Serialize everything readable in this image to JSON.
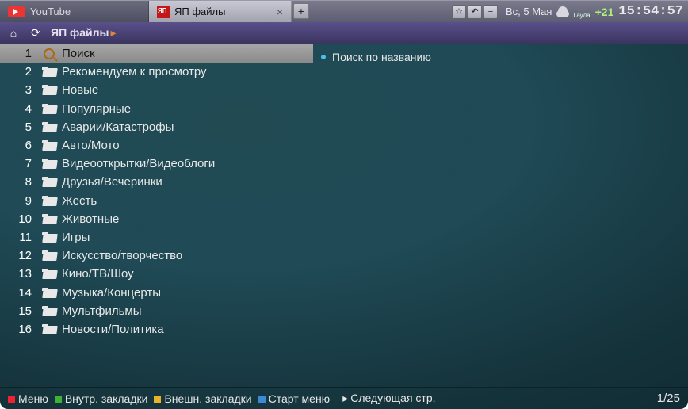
{
  "tabs": {
    "inactive_label": "YouTube",
    "active_label": "ЯП файлы"
  },
  "status": {
    "date": "Вс, 5 Мая",
    "city": "Гаула",
    "temp": "+21",
    "time": "15:54:57"
  },
  "toolbar": {
    "crumb": "ЯП файлы"
  },
  "detail": {
    "desc": "Поиск по названию"
  },
  "list": {
    "items": [
      {
        "n": "1",
        "type": "search",
        "label": "Поиск",
        "selected": true
      },
      {
        "n": "2",
        "type": "folder",
        "label": "Рекомендуем к просмотру"
      },
      {
        "n": "3",
        "type": "folder",
        "label": "Новые"
      },
      {
        "n": "4",
        "type": "folder",
        "label": "Популярные"
      },
      {
        "n": "5",
        "type": "folder",
        "label": "Аварии/Катастрофы"
      },
      {
        "n": "6",
        "type": "folder",
        "label": "Авто/Мото"
      },
      {
        "n": "7",
        "type": "folder",
        "label": "Видеооткрытки/Видеоблоги"
      },
      {
        "n": "8",
        "type": "folder",
        "label": "Друзья/Вечеринки"
      },
      {
        "n": "9",
        "type": "folder",
        "label": "Жесть"
      },
      {
        "n": "10",
        "type": "folder",
        "label": "Животные"
      },
      {
        "n": "11",
        "type": "folder",
        "label": "Игры"
      },
      {
        "n": "12",
        "type": "folder",
        "label": "Искусство/творчество"
      },
      {
        "n": "13",
        "type": "folder",
        "label": "Кино/ТВ/Шоу"
      },
      {
        "n": "14",
        "type": "folder",
        "label": "Музыка/Концерты"
      },
      {
        "n": "15",
        "type": "folder",
        "label": "Мультфильмы"
      },
      {
        "n": "16",
        "type": "folder",
        "label": "Новости/Политика"
      }
    ]
  },
  "legend": {
    "red": "Меню",
    "green": "Внутр. закладки",
    "yellow": "Внешн. закладки",
    "blue": "Старт меню",
    "next": "Следующая стр.",
    "page": "1/25"
  }
}
